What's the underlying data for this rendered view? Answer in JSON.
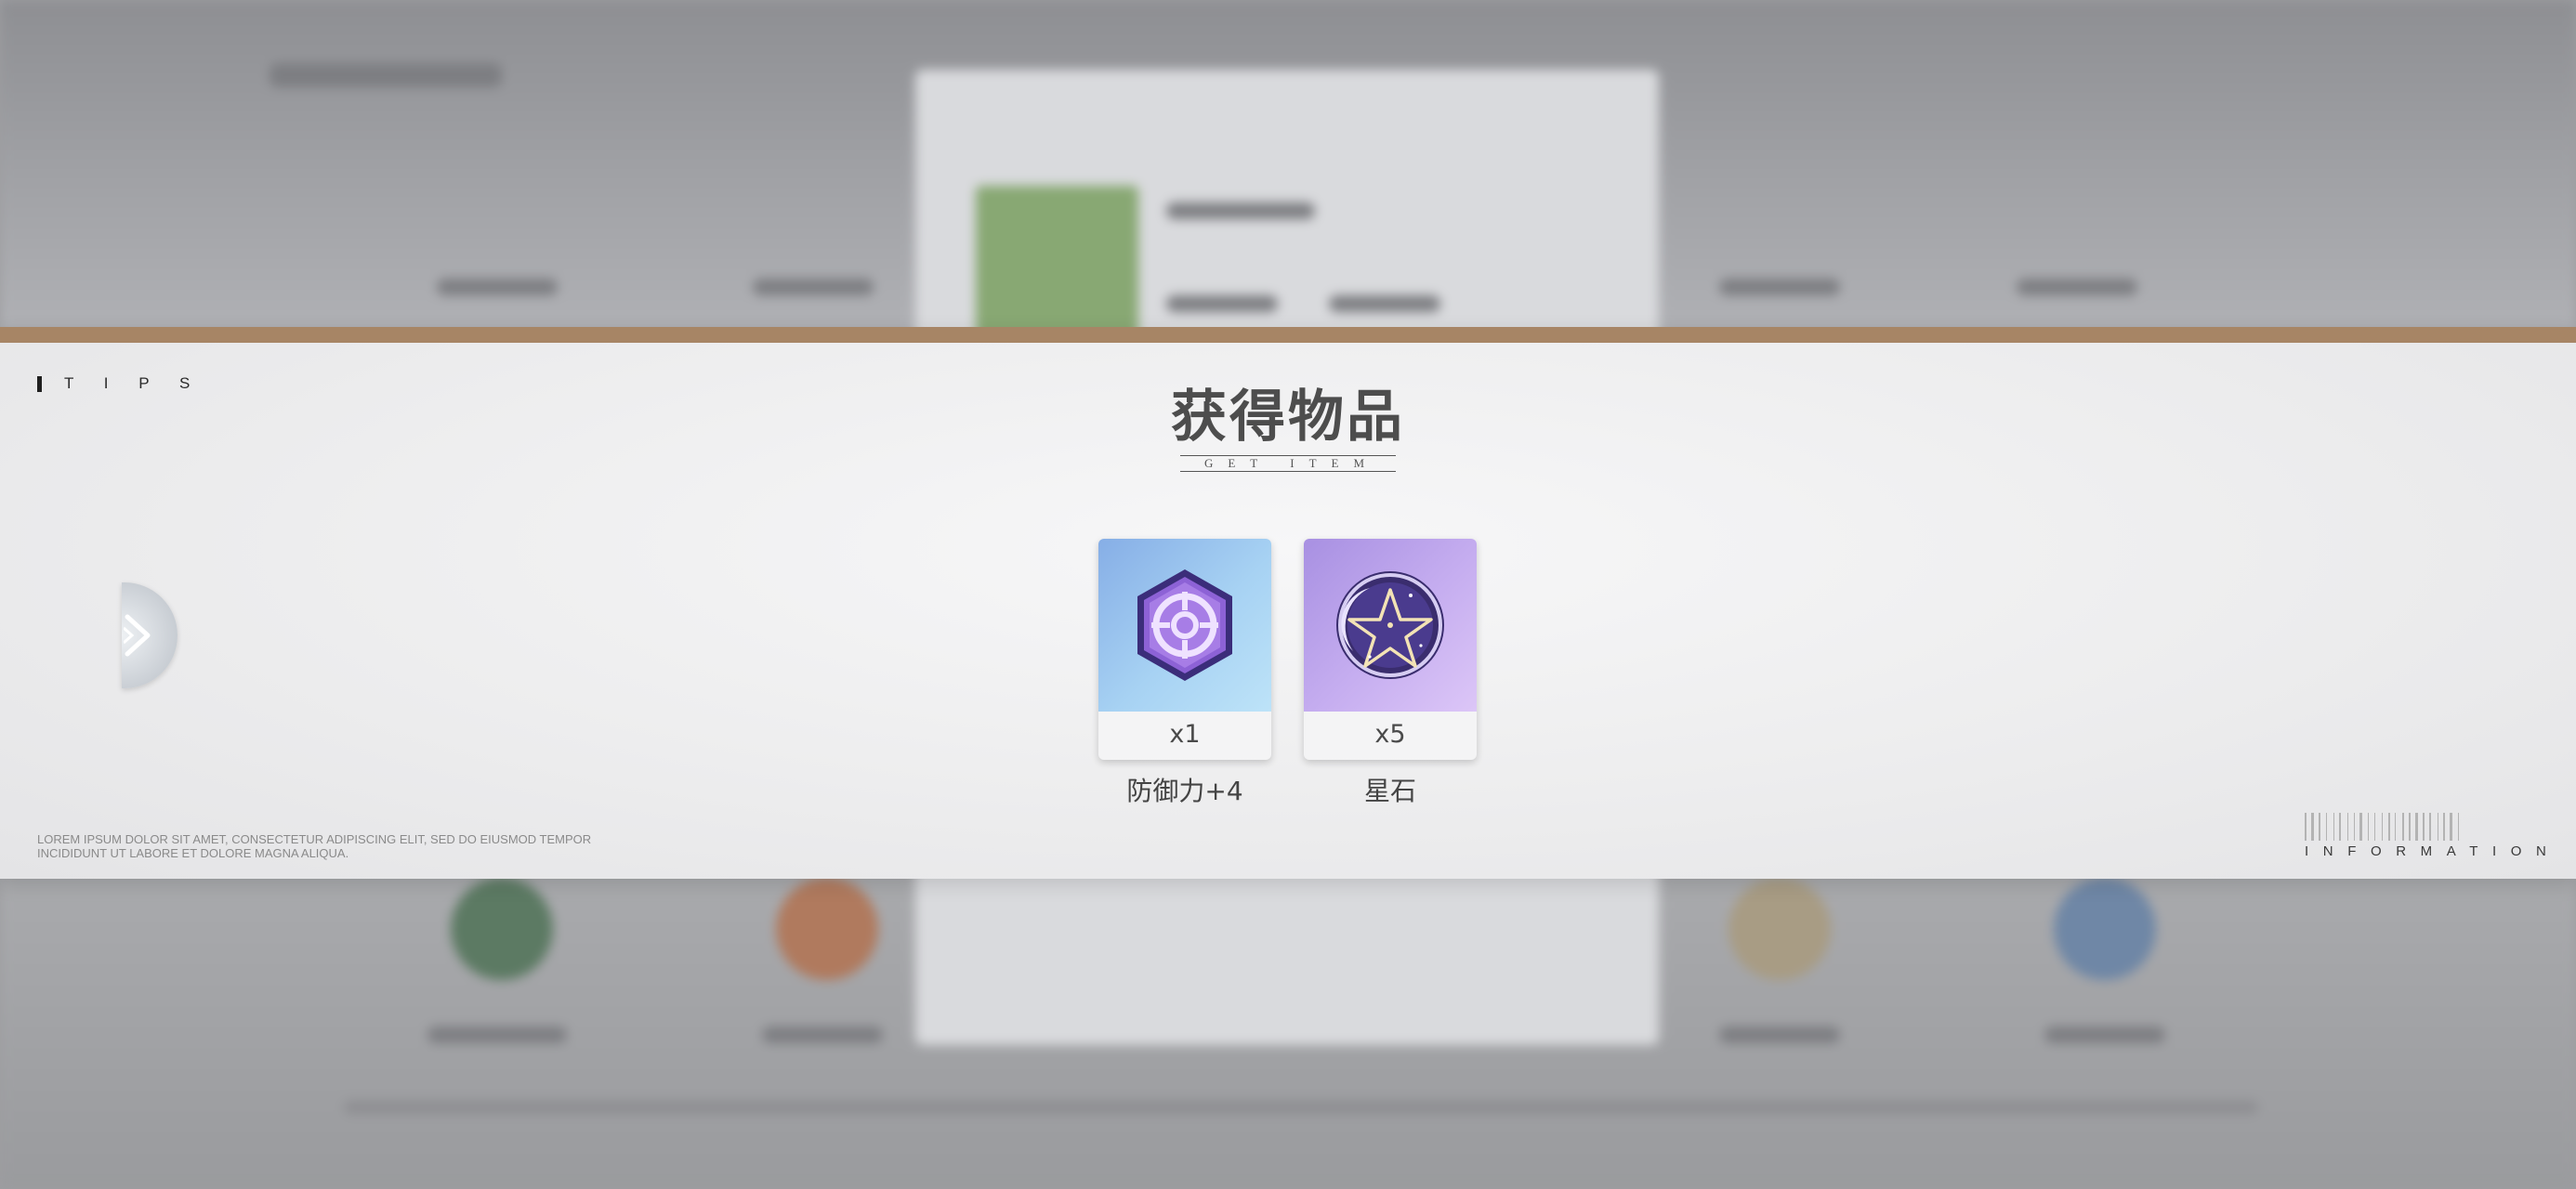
{
  "header": {
    "tips_label": "T I P S",
    "title": "获得物品",
    "subtitle": "GET ITEM"
  },
  "items": [
    {
      "icon": "defense-shield-target-icon",
      "quantity": "x1",
      "name": "防御力+4"
    },
    {
      "icon": "pentagram-star-stone-icon",
      "quantity": "x5",
      "name": "星石"
    }
  ],
  "footer": {
    "lorem": "LOREM IPSUM DOLOR SIT AMET, CONSECTETUR ADIPISCING ELIT, SED DO EIUSMOD TEMPOR INCIDIDUNT UT LABORE ET DOLORE MAGNA ALIQUA.",
    "info_label": "INFORMATION"
  },
  "colors": {
    "accent_bar": "#a78565",
    "title_text": "#4d4d4d",
    "card_blue": "#9cc6f0",
    "card_purple": "#c2a9ee"
  }
}
